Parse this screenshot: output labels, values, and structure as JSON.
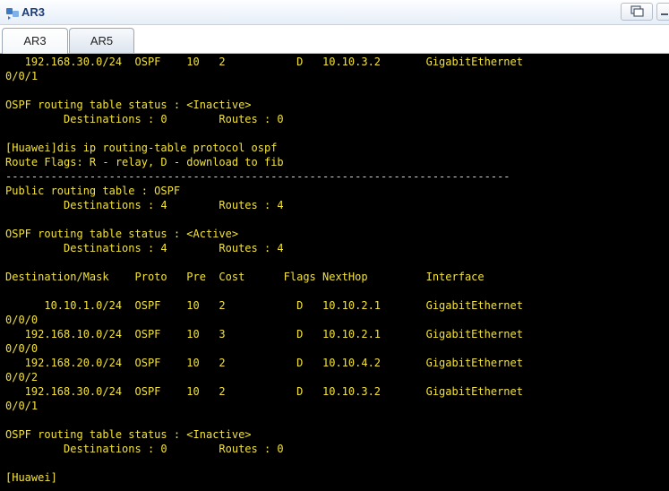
{
  "window": {
    "title": "AR3",
    "icon": "router-app-icon",
    "controls": [
      "restore-icon",
      "minimize-icon"
    ]
  },
  "tabs": [
    {
      "label": "AR3",
      "active": true
    },
    {
      "label": "AR5",
      "active": false
    }
  ],
  "terminal": {
    "text_color": "#f2e23a",
    "background": "#000000",
    "lines": [
      "   192.168.30.0/24  OSPF    10   2           D   10.10.3.2       GigabitEthernet",
      "0/0/1",
      "",
      "OSPF routing table status : <Inactive>",
      "         Destinations : 0        Routes : 0",
      "",
      "[Huawei]dis ip routing-table protocol ospf",
      "Route Flags: R - relay, D - download to fib",
      "------------------------------------------------------------------------------",
      "Public routing table : OSPF",
      "         Destinations : 4        Routes : 4",
      "",
      "OSPF routing table status : <Active>",
      "         Destinations : 4        Routes : 4",
      "",
      "Destination/Mask    Proto   Pre  Cost      Flags NextHop         Interface",
      "",
      "      10.10.1.0/24  OSPF    10   2           D   10.10.2.1       GigabitEthernet",
      "0/0/0",
      "   192.168.10.0/24  OSPF    10   3           D   10.10.2.1       GigabitEthernet",
      "0/0/0",
      "   192.168.20.0/24  OSPF    10   2           D   10.10.4.2       GigabitEthernet",
      "0/0/2",
      "   192.168.30.0/24  OSPF    10   2           D   10.10.3.2       GigabitEthernet",
      "0/0/1",
      "",
      "OSPF routing table status : <Inactive>",
      "         Destinations : 0        Routes : 0",
      "",
      "[Huawei]"
    ]
  }
}
